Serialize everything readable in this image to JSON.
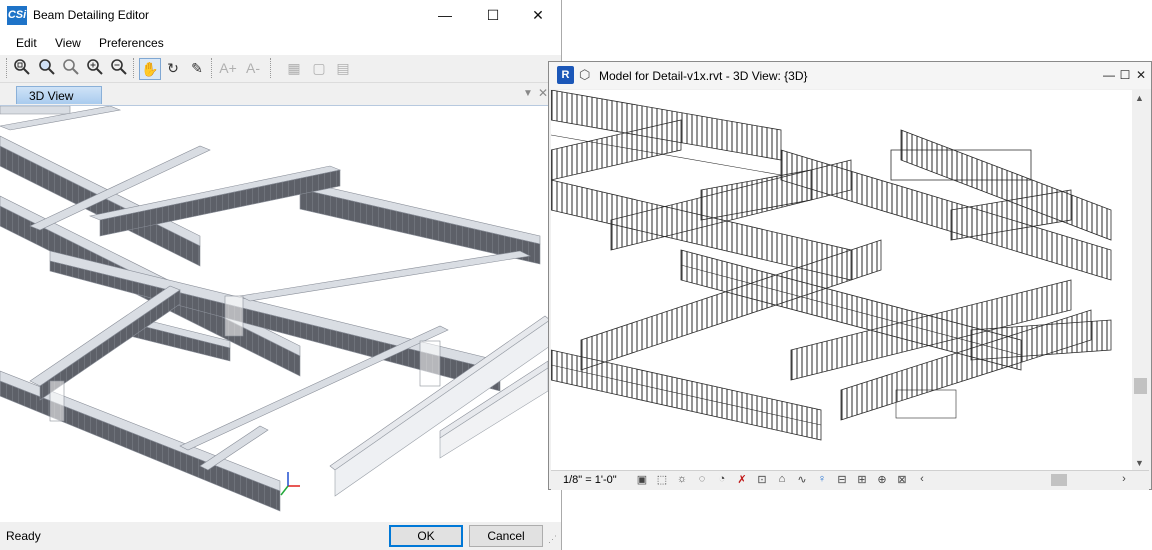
{
  "left_window": {
    "app_icon_text": "CSi",
    "title": "Beam Detailing Editor",
    "caption_buttons": {
      "minimize": "—",
      "maximize": "☐",
      "close": "✕"
    },
    "menu": [
      "Edit",
      "View",
      "Preferences"
    ],
    "toolbar_icons": [
      "zoom-window-icon",
      "zoom-fit-icon",
      "zoom-previous-icon",
      "zoom-in-icon",
      "zoom-out-icon",
      "pan-icon",
      "rotate-icon",
      "edit-icon",
      "font-increase-icon",
      "font-decrease-icon",
      "toggle-rebar-icon",
      "toggle-section-icon",
      "toggle-panel-icon"
    ],
    "font_increase_label": "A+",
    "font_decrease_label": "A-",
    "tab_label": "3D View",
    "status": "Ready",
    "ok_label": "OK",
    "cancel_label": "Cancel"
  },
  "right_window": {
    "app_icon_text": "R",
    "title": "Model for Detail-v1x.rvt - 3D View: {3D}",
    "scale": "1/8\" = 1'-0\"",
    "view_control_icons": [
      "detail-level-icon",
      "visual-style-icon",
      "sun-path-icon",
      "shadows-icon",
      "render-icon",
      "crop-view-icon",
      "show-crop-icon",
      "unlock-3d-icon",
      "temporary-hide-icon",
      "reveal-hidden-icon",
      "temporary-properties-icon",
      "worksharing-icon",
      "analytical-model-icon",
      "highlight-displacement-icon",
      "constraints-icon"
    ]
  },
  "colors": {
    "beam_fill": "#5d6068",
    "beam_top": "#d9dde3",
    "rebar": "#2a2a2a",
    "tab_active": "#b9d5f2",
    "default_button_border": "#0078d7"
  }
}
